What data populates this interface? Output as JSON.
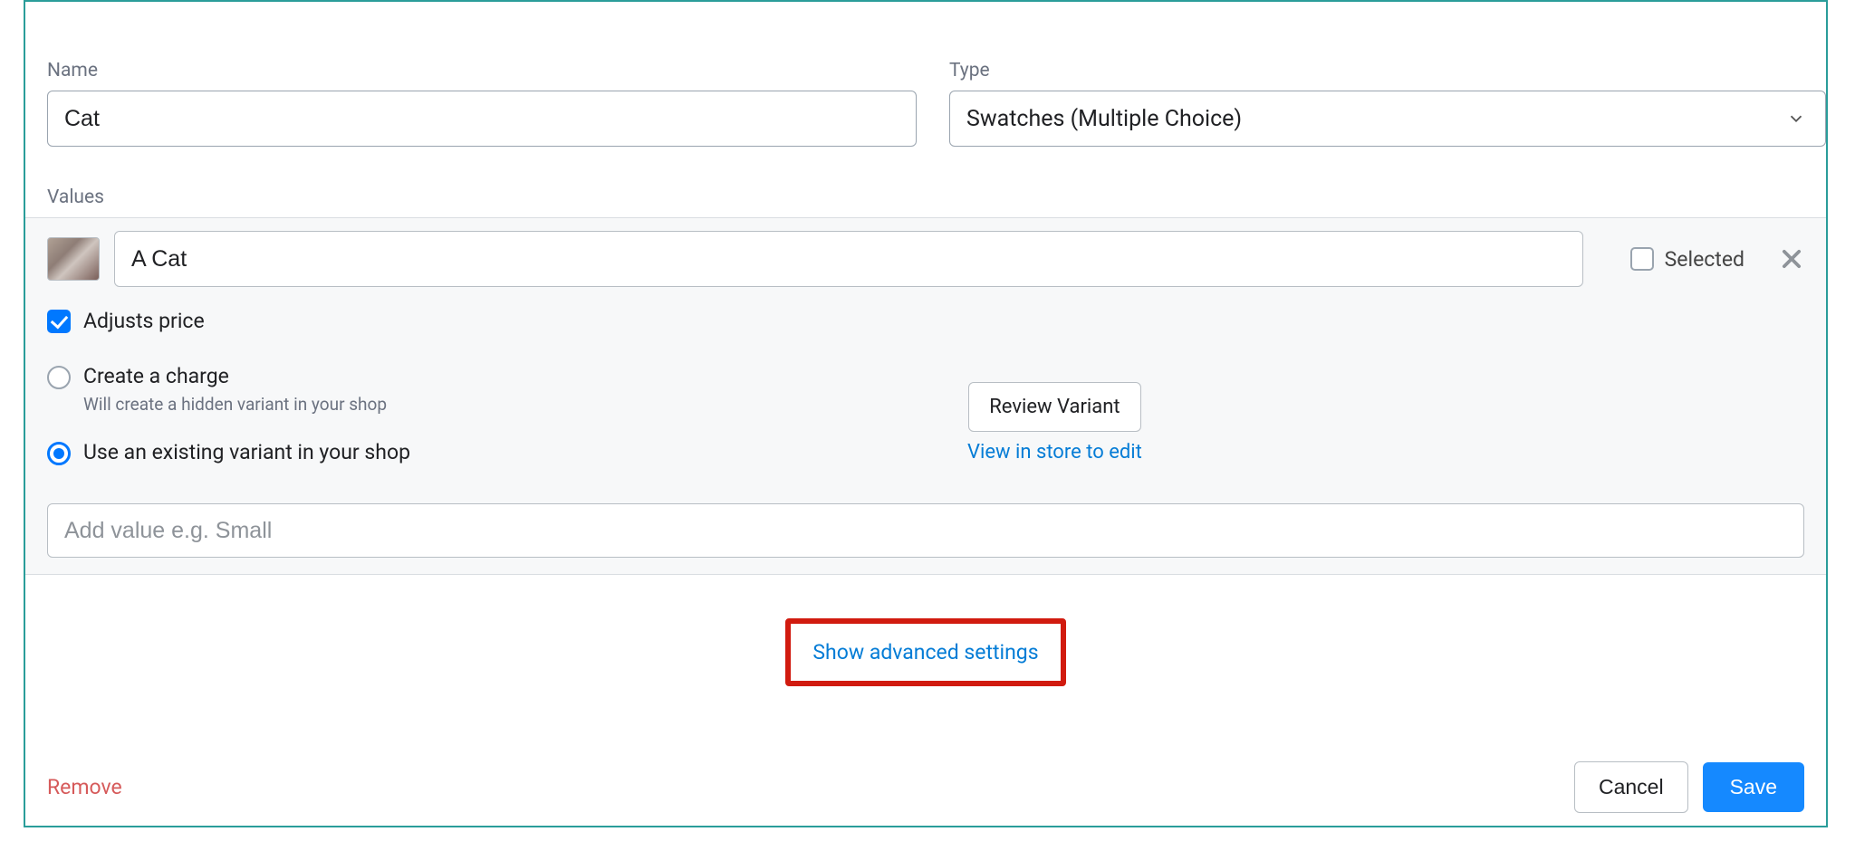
{
  "fields": {
    "name_label": "Name",
    "name_value": "Cat",
    "type_label": "Type",
    "type_selected": "Swatches (Multiple Choice)",
    "values_label": "Values"
  },
  "value_row": {
    "value_text": "A Cat",
    "selected_label": "Selected",
    "selected_checked": false
  },
  "adjusts_price": {
    "label": "Adjusts price",
    "checked": true
  },
  "charge_option": {
    "label": "Create a charge",
    "hint": "Will create a hidden variant in your shop",
    "selected": false
  },
  "existing_option": {
    "label": "Use an existing variant in your shop",
    "selected": true
  },
  "review": {
    "button": "Review Variant",
    "link": "View in store to edit"
  },
  "add_value_placeholder": "Add value e.g. Small",
  "advanced_link": "Show advanced settings",
  "footer": {
    "remove": "Remove",
    "cancel": "Cancel",
    "save": "Save"
  },
  "colors": {
    "accent": "#0078ff",
    "link": "#047cd6",
    "panel_border": "#2a9d9a",
    "highlight_border": "#d11b0f",
    "danger": "#d65a5a"
  }
}
